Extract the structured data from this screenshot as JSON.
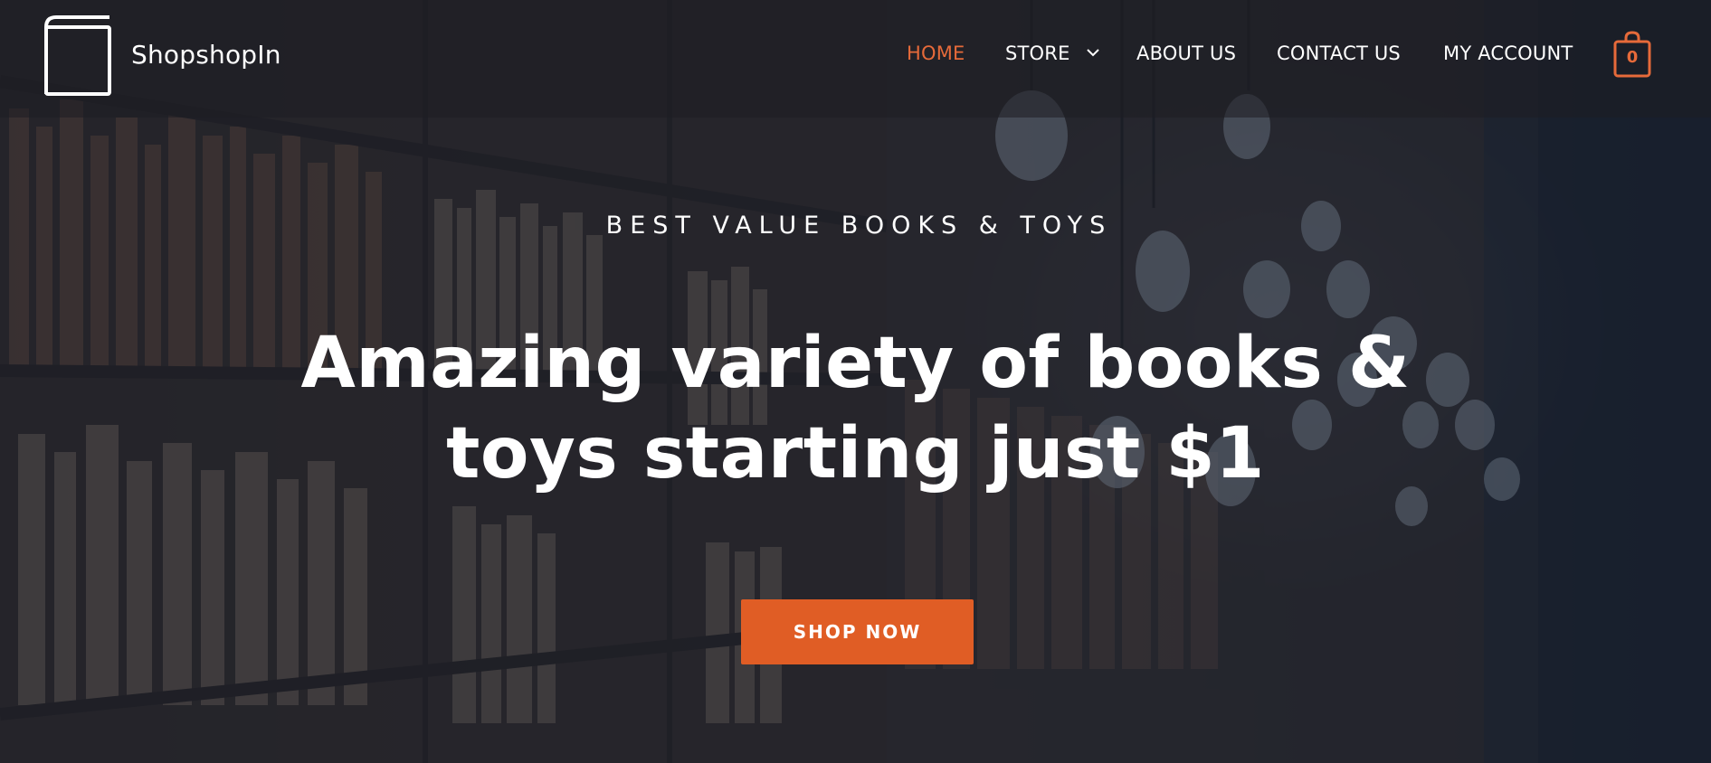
{
  "header": {
    "site_title": "ShopshopIn",
    "logo_icon": "book-icon"
  },
  "nav": {
    "home": "HOME",
    "store": "STORE",
    "about": "ABOUT US",
    "contact": "CONTACT US",
    "account": "MY ACCOUNT",
    "active": "HOME"
  },
  "cart": {
    "count": "0",
    "icon": "shopping-bag-icon"
  },
  "hero": {
    "eyebrow": "BEST VALUE BOOKS & TOYS",
    "headline": "Amazing variety of books & toys starting just $1",
    "cta_label": "SHOP NOW"
  },
  "colors": {
    "accent": "#e05d25",
    "nav_active": "#e66a3a",
    "text": "#ffffff",
    "overlay": "#161e2c"
  }
}
